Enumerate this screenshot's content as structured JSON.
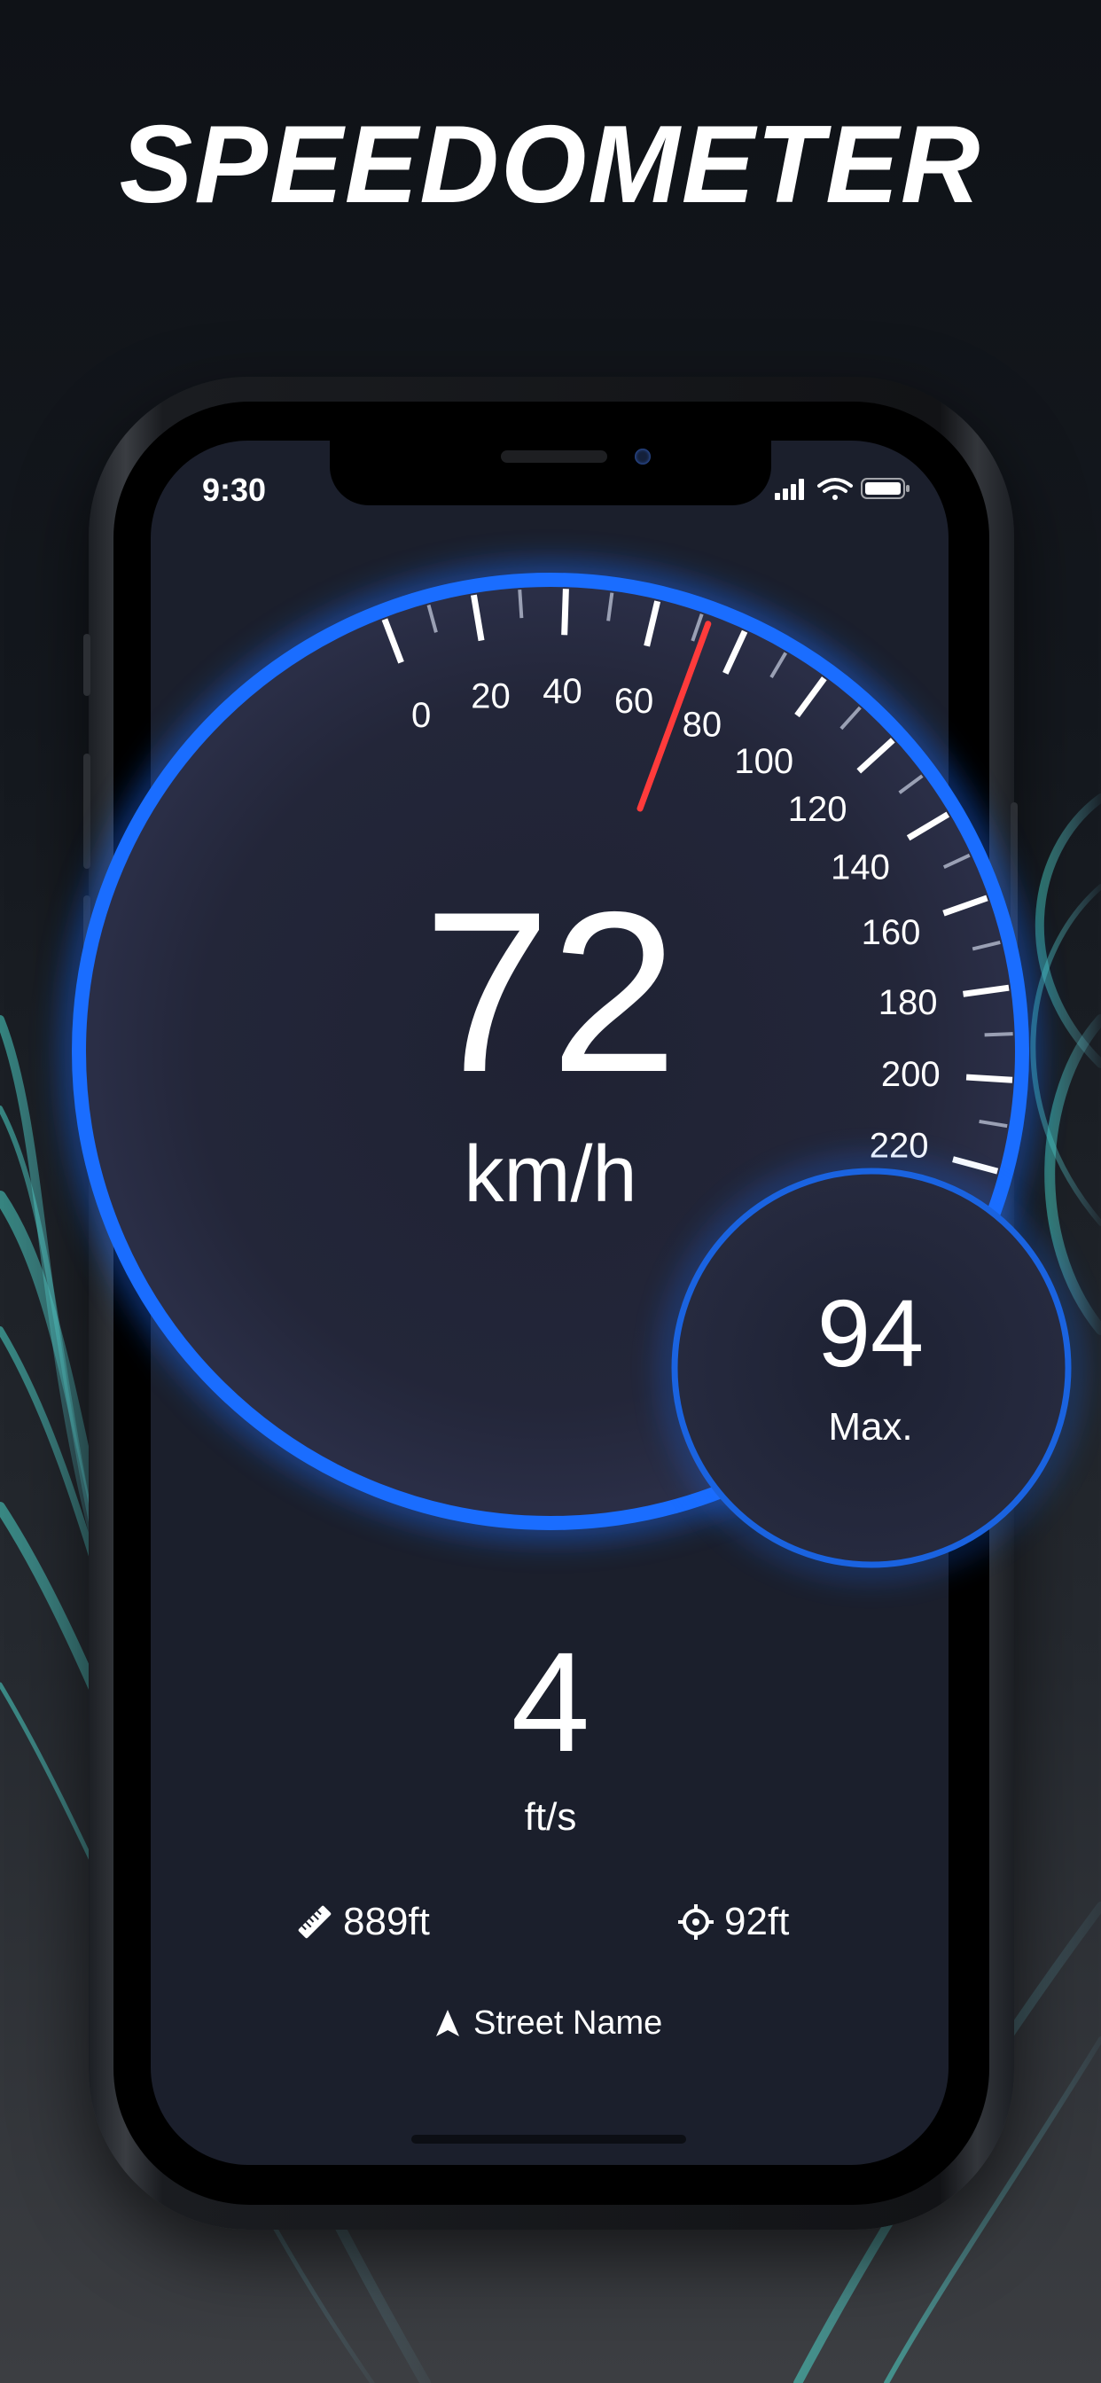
{
  "headline": "SPEEDOMETER",
  "status_bar": {
    "time": "9:30"
  },
  "speedometer": {
    "current_speed": "72",
    "unit": "km/h",
    "needle_speed": 72,
    "scale_min": 0,
    "scale_max": 220,
    "tick_labels": [
      "0",
      "20",
      "40",
      "60",
      "80",
      "100",
      "120",
      "140",
      "160",
      "180",
      "200",
      "220"
    ]
  },
  "max_speed": {
    "value": "94",
    "label": "Max."
  },
  "secondary_speed": {
    "value": "4",
    "unit": "ft/s"
  },
  "stats": {
    "distance": "889ft",
    "altitude": "92ft"
  },
  "location": {
    "street": "Street Name"
  },
  "icons": {
    "distance": "ruler-icon",
    "altitude": "crosshair-icon",
    "location": "navigation-arrow-icon",
    "signal": "cellular-signal-icon",
    "wifi": "wifi-icon",
    "battery": "battery-icon"
  },
  "colors": {
    "accent": "#1a6dff",
    "needle": "#ff3b3b",
    "screen_bg": "#1b1f2c"
  }
}
